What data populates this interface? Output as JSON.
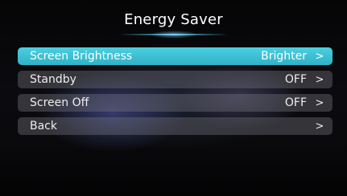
{
  "header": {
    "title": "Energy Saver"
  },
  "menu": {
    "items": [
      {
        "label": "Screen Brightness",
        "value": "Brighter",
        "icon": "chevron-right-icon",
        "selected": true
      },
      {
        "label": "Standby",
        "value": "OFF",
        "icon": "chevron-right-icon",
        "selected": false
      },
      {
        "label": "Screen Off",
        "value": "OFF",
        "icon": "chevron-right-icon",
        "selected": false
      },
      {
        "label": "Back",
        "value": "",
        "icon": "chevron-right-icon",
        "selected": false
      }
    ],
    "chevron_glyph": ">"
  },
  "colors": {
    "accent": "#3cc0d3",
    "item_background": "#4a4a52",
    "text": "#f2f2f2"
  }
}
